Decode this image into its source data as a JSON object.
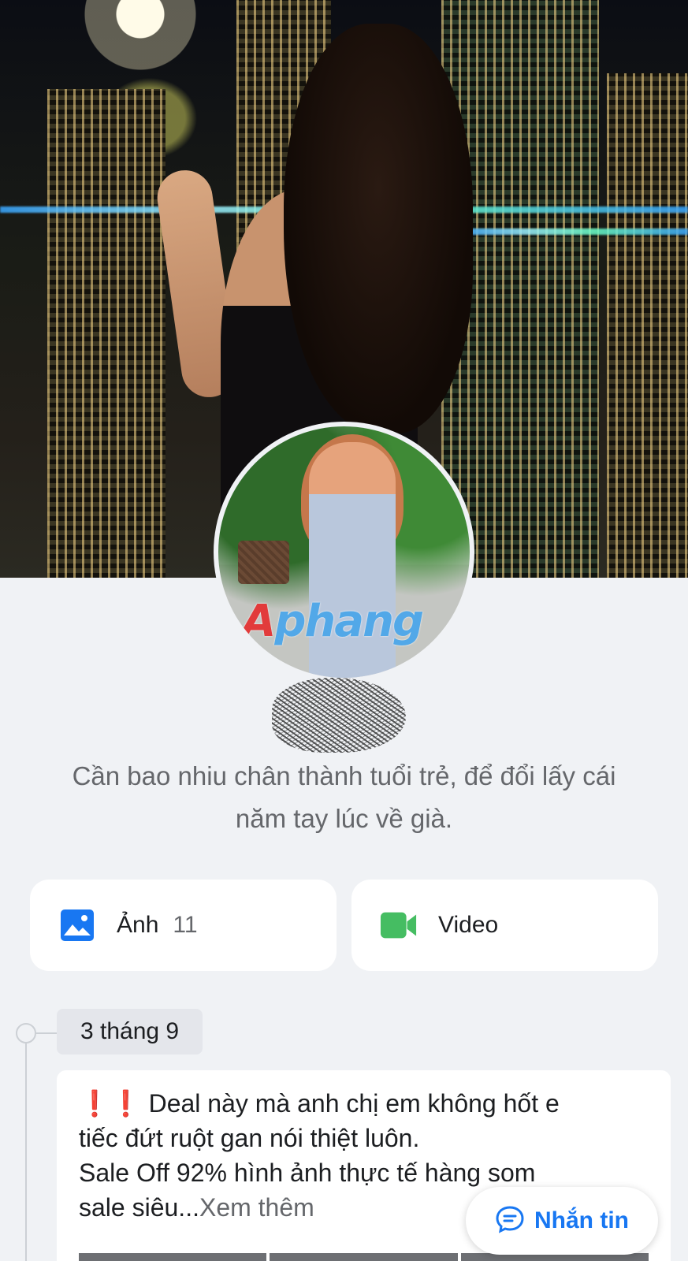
{
  "cover_photo": {
    "alt": ""
  },
  "avatar": {
    "watermark_part1": "A",
    "watermark_part2": "phang"
  },
  "profile": {
    "bio_line1": "Cần bao nhiu chân thành tuổi trẻ, để đổi lấy cái",
    "bio_line2": "năm tay lúc về già."
  },
  "media_cards": {
    "photos": {
      "label": "Ảnh",
      "count": "11",
      "icon": "image-icon",
      "color": "#1877f2"
    },
    "videos": {
      "label": "Video",
      "icon": "video-camera-icon",
      "color": "#45bd62"
    }
  },
  "timeline": {
    "date": "3 tháng 9"
  },
  "post": {
    "line1": "Deal này mà anh chị em không hốt e",
    "line2": "tiếc đứt ruột gan nói thiệt luôn.",
    "line3": "Sale Off 92% hình ảnh thực tế hàng som",
    "line4_prefix": "sale siêu...",
    "see_more": "Xem thêm",
    "emoji": "❗❗"
  },
  "message_button": {
    "label": "Nhắn tin",
    "icon": "messenger-icon",
    "color": "#1877f2"
  }
}
